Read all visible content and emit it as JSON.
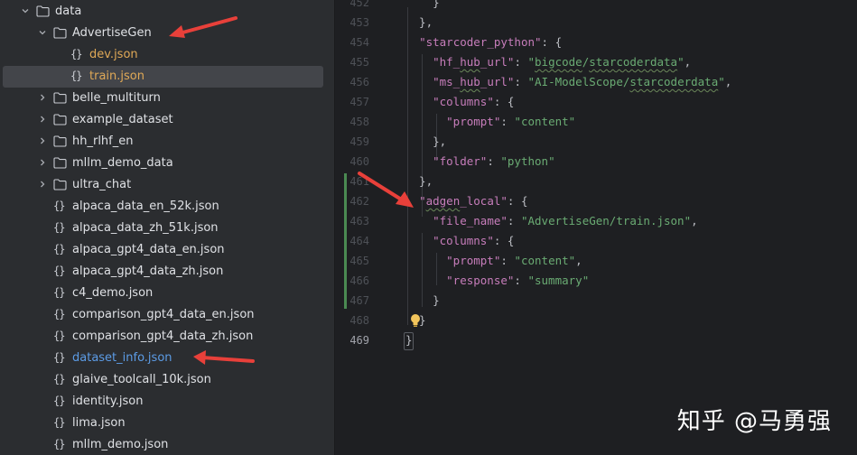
{
  "tree": {
    "items": [
      {
        "label": "data",
        "type": "folder",
        "expanded": true,
        "indent": 0
      },
      {
        "label": "AdvertiseGen",
        "type": "folder",
        "expanded": true,
        "indent": 1
      },
      {
        "label": "dev.json",
        "type": "json",
        "indent": 2,
        "color": "#e0a957"
      },
      {
        "label": "train.json",
        "type": "json",
        "indent": 2,
        "color": "#e0a957",
        "selected": true
      },
      {
        "label": "belle_multiturn",
        "type": "folder",
        "expanded": false,
        "indent": 1
      },
      {
        "label": "example_dataset",
        "type": "folder",
        "expanded": false,
        "indent": 1
      },
      {
        "label": "hh_rlhf_en",
        "type": "folder",
        "expanded": false,
        "indent": 1
      },
      {
        "label": "mllm_demo_data",
        "type": "folder",
        "expanded": false,
        "indent": 1
      },
      {
        "label": "ultra_chat",
        "type": "folder",
        "expanded": false,
        "indent": 1
      },
      {
        "label": "alpaca_data_en_52k.json",
        "type": "json",
        "indent": 1
      },
      {
        "label": "alpaca_data_zh_51k.json",
        "type": "json",
        "indent": 1
      },
      {
        "label": "alpaca_gpt4_data_en.json",
        "type": "json",
        "indent": 1
      },
      {
        "label": "alpaca_gpt4_data_zh.json",
        "type": "json",
        "indent": 1
      },
      {
        "label": "c4_demo.json",
        "type": "json",
        "indent": 1
      },
      {
        "label": "comparison_gpt4_data_en.json",
        "type": "json",
        "indent": 1
      },
      {
        "label": "comparison_gpt4_data_zh.json",
        "type": "json",
        "indent": 1
      },
      {
        "label": "dataset_info.json",
        "type": "json",
        "indent": 1,
        "color": "#5c9ce6"
      },
      {
        "label": "glaive_toolcall_10k.json",
        "type": "json",
        "indent": 1
      },
      {
        "label": "identity.json",
        "type": "json",
        "indent": 1
      },
      {
        "label": "lima.json",
        "type": "json",
        "indent": 1
      },
      {
        "label": "mllm_demo.json",
        "type": "json",
        "indent": 1
      }
    ]
  },
  "editor": {
    "lines": [
      {
        "n": "452",
        "text": "    }"
      },
      {
        "n": "453",
        "text": "  },"
      },
      {
        "n": "454",
        "text": "  \"starcoder_python\": {"
      },
      {
        "n": "455",
        "text": "    \"hf_hub_url\": \"bigcode/starcoderdata\","
      },
      {
        "n": "456",
        "text": "    \"ms_hub_url\": \"AI-ModelScope/starcoderdata\","
      },
      {
        "n": "457",
        "text": "    \"columns\": {"
      },
      {
        "n": "458",
        "text": "      \"prompt\": \"content\""
      },
      {
        "n": "459",
        "text": "    },"
      },
      {
        "n": "460",
        "text": "    \"folder\": \"python\""
      },
      {
        "n": "461",
        "text": "  },"
      },
      {
        "n": "462",
        "text": "  \"adgen_local\": {"
      },
      {
        "n": "463",
        "text": "    \"file_name\": \"AdvertiseGen/train.json\","
      },
      {
        "n": "464",
        "text": "    \"columns\": {"
      },
      {
        "n": "465",
        "text": "      \"prompt\": \"content\","
      },
      {
        "n": "466",
        "text": "      \"response\": \"summary\""
      },
      {
        "n": "467",
        "text": "    }"
      },
      {
        "n": "468",
        "text": "  }"
      },
      {
        "n": "469",
        "text": "}"
      }
    ]
  },
  "colors": {
    "key": "#c77dbb",
    "string": "#6aab73",
    "arrow": "#e8403a",
    "changed_line_bar": "#4a8a52"
  },
  "watermark": "知乎 @马勇强"
}
